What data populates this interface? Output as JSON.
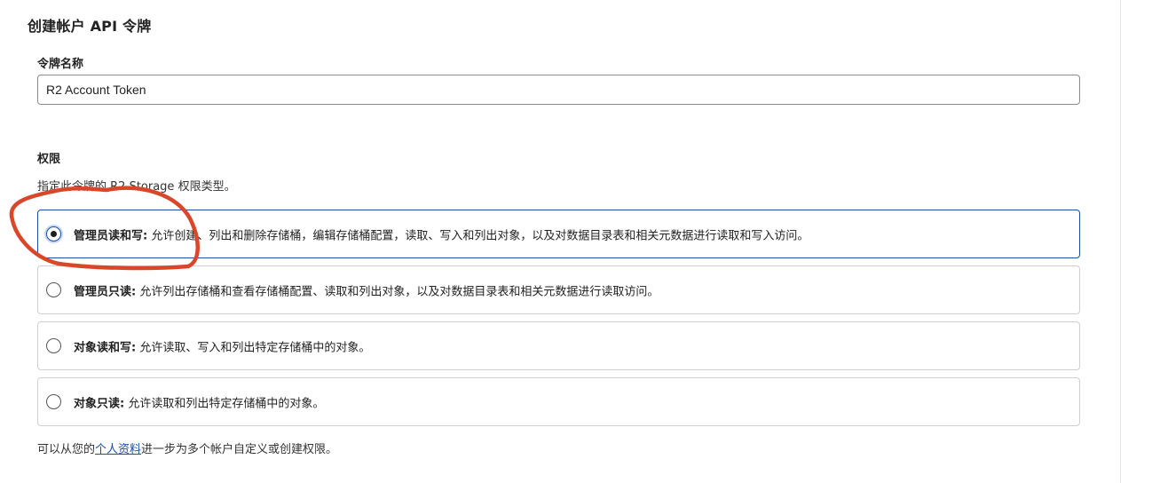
{
  "page": {
    "title": "创建帐户 API 令牌"
  },
  "token_name": {
    "label": "令牌名称",
    "value": "R2 Account Token"
  },
  "permissions": {
    "label": "权限",
    "description": "指定此令牌的 R2 Storage 权限类型。",
    "options": [
      {
        "name": "管理员读和写:",
        "description": " 允许创建、列出和删除存储桶，编辑存储桶配置，读取、写入和列出对象，以及对数据目录表和相关元数据进行读取和写入访问。",
        "selected": true
      },
      {
        "name": "管理员只读:",
        "description": " 允许列出存储桶和查看存储桶配置、读取和列出对象，以及对数据目录表和相关元数据进行读取访问。",
        "selected": false
      },
      {
        "name": "对象读和写:",
        "description": " 允许读取、写入和列出特定存储桶中的对象。",
        "selected": false
      },
      {
        "name": "对象只读:",
        "description": " 允许读取和列出特定存储桶中的对象。",
        "selected": false
      }
    ]
  },
  "footer": {
    "prefix": "可以从您的",
    "link": "个人资料",
    "suffix": "进一步为多个帐户自定义或创建权限。"
  },
  "colors": {
    "accent": "#1a4fa6",
    "annotation": "#d9472b"
  }
}
